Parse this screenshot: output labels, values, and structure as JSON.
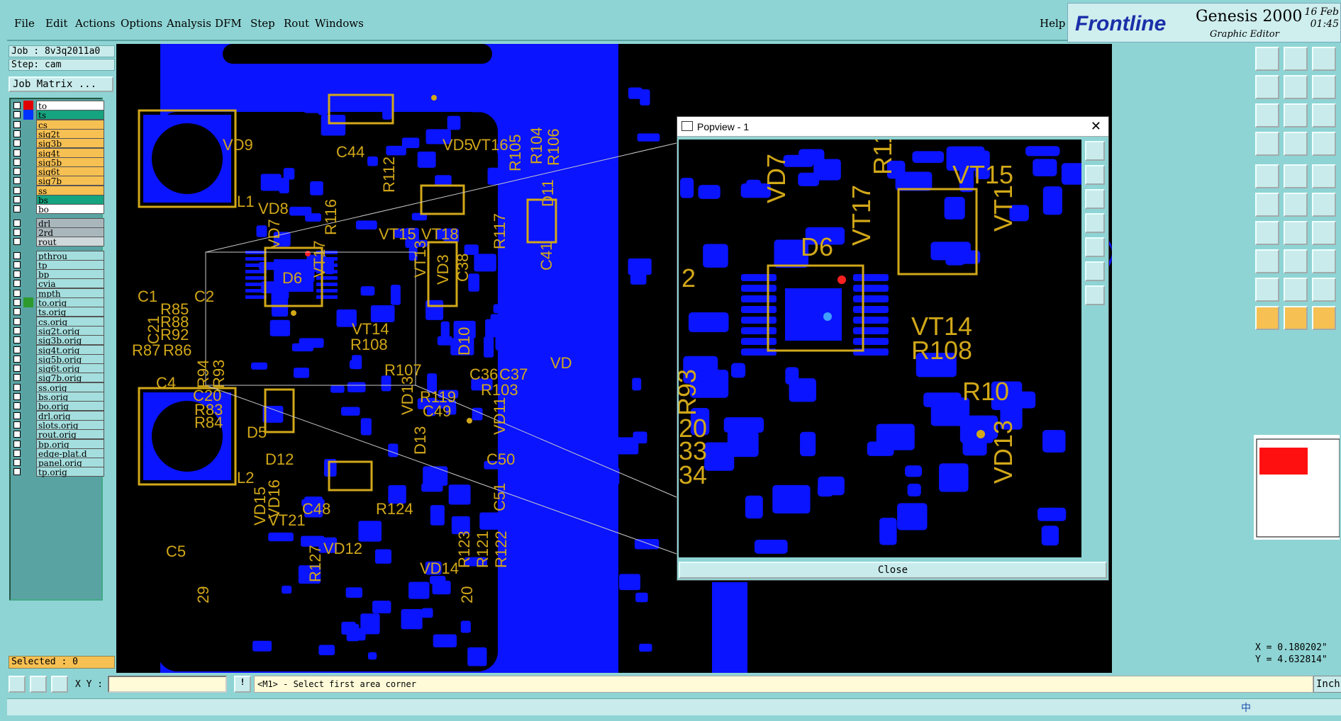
{
  "menu": {
    "items": [
      {
        "label": "File"
      },
      {
        "label": "Edit"
      },
      {
        "label": "Actions"
      },
      {
        "label": "Options"
      },
      {
        "label": "Analysis"
      },
      {
        "label": "DFM"
      },
      {
        "label": "Step"
      },
      {
        "label": "Rout"
      },
      {
        "label": "Windows"
      }
    ],
    "help": "Help"
  },
  "brand": {
    "logo": "Frontline",
    "product": "Genesis 2000",
    "subtitle": "Graphic Editor",
    "date": "16 Feb",
    "time": "01:45"
  },
  "job": {
    "job_line": "Job : 8v3q2011a0",
    "step_line": "Step: cam",
    "matrix_button": "Job Matrix ..."
  },
  "layers": [
    {
      "name": "to",
      "color": "#ffffff",
      "swatch": "#e00000"
    },
    {
      "name": "ts",
      "color": "#16a37f",
      "swatch": "#0033ff"
    },
    {
      "name": "cs",
      "color": "#f7c052",
      "swatch": ""
    },
    {
      "name": "sig2t",
      "color": "#f7c052",
      "swatch": ""
    },
    {
      "name": "sig3b",
      "color": "#f7c052",
      "swatch": ""
    },
    {
      "name": "sig4t",
      "color": "#f7c052",
      "swatch": ""
    },
    {
      "name": "sig5b",
      "color": "#f7c052",
      "swatch": ""
    },
    {
      "name": "sig6t",
      "color": "#f7c052",
      "swatch": ""
    },
    {
      "name": "sig7b",
      "color": "#f7c052",
      "swatch": ""
    },
    {
      "name": "ss",
      "color": "#f7c052",
      "swatch": ""
    },
    {
      "name": "bs",
      "color": "#16a37f",
      "swatch": ""
    },
    {
      "name": "bo",
      "color": "#ffffff",
      "swatch": ""
    },
    {
      "name": "drl",
      "color": "#a9b7bd",
      "swatch": ""
    },
    {
      "name": "2rd",
      "color": "#a9b7bd",
      "swatch": ""
    },
    {
      "name": "rout",
      "color": "#cfd8da",
      "swatch": ""
    },
    {
      "name": "pthrou",
      "color": "#a5dede",
      "swatch": ""
    },
    {
      "name": "tp",
      "color": "#a5dede",
      "swatch": ""
    },
    {
      "name": "bp",
      "color": "#a5dede",
      "swatch": ""
    },
    {
      "name": "cvia",
      "color": "#a5dede",
      "swatch": ""
    },
    {
      "name": "mpth",
      "color": "#a5dede",
      "swatch": ""
    },
    {
      "name": "to.orig",
      "color": "#a5dede",
      "swatch": "#2c9a2c"
    },
    {
      "name": "ts.orig",
      "color": "#a5dede",
      "swatch": ""
    },
    {
      "name": "cs.orig",
      "color": "#a5dede",
      "swatch": ""
    },
    {
      "name": "sig2t.orig",
      "color": "#a5dede",
      "swatch": ""
    },
    {
      "name": "sig3b.orig",
      "color": "#a5dede",
      "swatch": ""
    },
    {
      "name": "sig4t.orig",
      "color": "#a5dede",
      "swatch": ""
    },
    {
      "name": "sig5b.orig",
      "color": "#a5dede",
      "swatch": ""
    },
    {
      "name": "sig6t.orig",
      "color": "#a5dede",
      "swatch": ""
    },
    {
      "name": "sig7b.orig",
      "color": "#a5dede",
      "swatch": ""
    },
    {
      "name": "ss.orig",
      "color": "#a5dede",
      "swatch": ""
    },
    {
      "name": "bs.orig",
      "color": "#a5dede",
      "swatch": ""
    },
    {
      "name": "bo.orig",
      "color": "#a5dede",
      "swatch": ""
    },
    {
      "name": "drl.orig",
      "color": "#a5dede",
      "swatch": ""
    },
    {
      "name": "slots.orig",
      "color": "#a5dede",
      "swatch": ""
    },
    {
      "name": "rout.orig",
      "color": "#a5dede",
      "swatch": ""
    },
    {
      "name": "bp.orig",
      "color": "#a5dede",
      "swatch": ""
    },
    {
      "name": "edge-plat.d",
      "color": "#a5dede",
      "swatch": ""
    },
    {
      "name": "panel.orig",
      "color": "#a5dede",
      "swatch": ""
    },
    {
      "name": "tp.orig",
      "color": "#a5dede",
      "swatch": ""
    }
  ],
  "selected": "Selected : 0",
  "canvas_labels": [
    "VD9",
    "C44",
    "R112",
    "VD5",
    "VT16",
    "R105",
    "R104",
    "R106",
    "L1",
    "VD8",
    "R116",
    "VD7",
    "VT17",
    "VT15",
    "VT18",
    "R117",
    "D11",
    "D6",
    "VT13",
    "VD3",
    "C38",
    "C41",
    "C1",
    "C2",
    "R85",
    "R88",
    "C21",
    "R92",
    "R87",
    "R86",
    "VT14",
    "R108",
    "D10",
    "R107",
    "C36",
    "C37",
    "R103",
    "VD",
    "C4",
    "R94",
    "R93",
    "C20",
    "R83",
    "R84",
    "R119",
    "VD13",
    "C49",
    "VD11",
    "D5",
    "D13",
    "D12",
    "C50",
    "L2",
    "VD15",
    "VD16",
    "C51",
    "C48",
    "R124",
    "VT21",
    "VD12",
    "R123",
    "R121",
    "R122",
    "C5",
    "R127",
    "VD14",
    "29",
    "20"
  ],
  "popview": {
    "title": "Popview - 1",
    "close_label": "Close",
    "labels": [
      "VD7",
      "VT17",
      "R11",
      "VT15",
      "VT1",
      "D6",
      "2",
      "VT14",
      "R108",
      "R10",
      "R93",
      "20",
      "33",
      "34",
      "VD13"
    ]
  },
  "coords": {
    "x": "X = 0.180202\"",
    "y": "Y = 4.632814\""
  },
  "bottom": {
    "xy_label": "X Y :",
    "xy_value": "",
    "info_icon": "!",
    "prompt": "<M1> - Select first area corner",
    "units": "Inch"
  },
  "tray": {
    "ime": "中"
  },
  "colors": {
    "copper": "#0a14ff",
    "silk": "#d2a819",
    "board": "#000000",
    "panel": "#8fd4d4"
  }
}
